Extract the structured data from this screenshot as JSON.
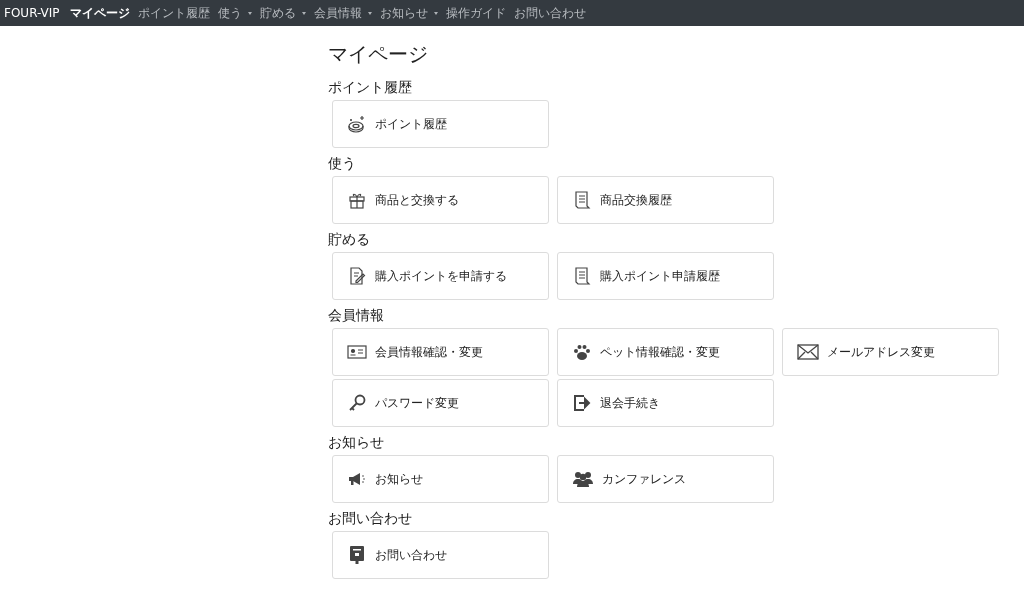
{
  "navbar": {
    "brand": "FOUR-VIP",
    "items": [
      {
        "label": "マイページ",
        "selected": true,
        "dropdown": false
      },
      {
        "label": "ポイント履歴",
        "selected": false,
        "dropdown": false
      },
      {
        "label": "使う",
        "selected": false,
        "dropdown": true
      },
      {
        "label": "貯める",
        "selected": false,
        "dropdown": true
      },
      {
        "label": "会員情報",
        "selected": false,
        "dropdown": true
      },
      {
        "label": "お知らせ",
        "selected": false,
        "dropdown": true
      },
      {
        "label": "操作ガイド",
        "selected": false,
        "dropdown": false
      },
      {
        "label": "お問い合わせ",
        "selected": false,
        "dropdown": false
      }
    ]
  },
  "page_title": "マイページ",
  "sections": [
    {
      "heading": "ポイント履歴",
      "cards": [
        {
          "label": "ポイント履歴",
          "kind": "coin"
        }
      ]
    },
    {
      "heading": "使う",
      "cards": [
        {
          "label": "商品と交換する",
          "kind": "gift"
        },
        {
          "label": "商品交換履歴",
          "kind": "receipt"
        }
      ]
    },
    {
      "heading": "貯める",
      "cards": [
        {
          "label": "購入ポイントを申請する",
          "kind": "form"
        },
        {
          "label": "購入ポイント申請履歴",
          "kind": "receipt"
        }
      ]
    },
    {
      "heading": "会員情報",
      "cards": [
        {
          "label": "会員情報確認・変更",
          "kind": "idcard"
        },
        {
          "label": "ペット情報確認・変更",
          "kind": "paw"
        },
        {
          "label": "メールアドレス変更",
          "kind": "mail"
        },
        {
          "label": "パスワード変更",
          "kind": "key"
        },
        {
          "label": "退会手続き",
          "kind": "exit"
        }
      ]
    },
    {
      "heading": "お知らせ",
      "cards": [
        {
          "label": "お知らせ",
          "kind": "megaphone"
        },
        {
          "label": "カンファレンス",
          "kind": "people"
        }
      ]
    },
    {
      "heading": "お問い合わせ",
      "cards": [
        {
          "label": "お問い合わせ",
          "kind": "postbox"
        }
      ]
    }
  ]
}
